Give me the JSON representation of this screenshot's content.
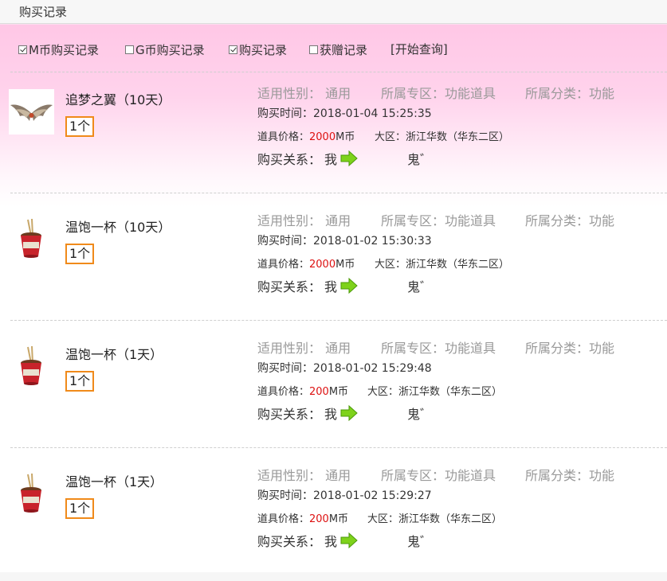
{
  "page": {
    "title": "购买记录"
  },
  "filters": {
    "items": [
      {
        "label": "M币购买记录",
        "checked": true
      },
      {
        "label": "G币购买记录",
        "checked": false
      },
      {
        "label": "购买记录",
        "checked": true
      },
      {
        "label": "获赠记录",
        "checked": false
      }
    ],
    "query_label": "[开始查询]"
  },
  "labels": {
    "gender": "适用性别：",
    "zone": "所属专区：",
    "category": "所属分类：",
    "time": "购买时间：",
    "price": "道具价格：",
    "region": "大区：",
    "relation": "购买关系："
  },
  "records": [
    {
      "name": "追梦之翼（10天）",
      "qty": "1个",
      "gender": "通用",
      "zone": "功能道具",
      "category": "功能",
      "time": "2018-01-04 15:25:35",
      "price_num": "2000",
      "price_unit": "M币",
      "region": "浙江华数（华东二区）",
      "buyer": "我",
      "target": "鬼゛",
      "icon": "wings-icon"
    },
    {
      "name": "温饱一杯（10天）",
      "qty": "1个",
      "gender": "通用",
      "zone": "功能道具",
      "category": "功能",
      "time": "2018-01-02 15:30:33",
      "price_num": "2000",
      "price_unit": "M币",
      "region": "浙江华数（华东二区）",
      "buyer": "我",
      "target": "鬼゛",
      "icon": "noodle-cup-icon"
    },
    {
      "name": "温饱一杯（1天）",
      "qty": "1个",
      "gender": "通用",
      "zone": "功能道具",
      "category": "功能",
      "time": "2018-01-02 15:29:48",
      "price_num": "200",
      "price_unit": "M币",
      "region": "浙江华数（华东二区）",
      "buyer": "我",
      "target": "鬼゛",
      "icon": "noodle-cup-icon"
    },
    {
      "name": "温饱一杯（1天）",
      "qty": "1个",
      "gender": "通用",
      "zone": "功能道具",
      "category": "功能",
      "time": "2018-01-02 15:29:27",
      "price_num": "200",
      "price_unit": "M币",
      "region": "浙江华数（华东二区）",
      "buyer": "我",
      "target": "鬼゛",
      "icon": "noodle-cup-icon"
    }
  ],
  "colors": {
    "accent_qty_border": "#f08a1a",
    "price_red": "#dd1111",
    "arrow_green": "#7ed21b",
    "pink_bg": "#ffc7e6"
  }
}
